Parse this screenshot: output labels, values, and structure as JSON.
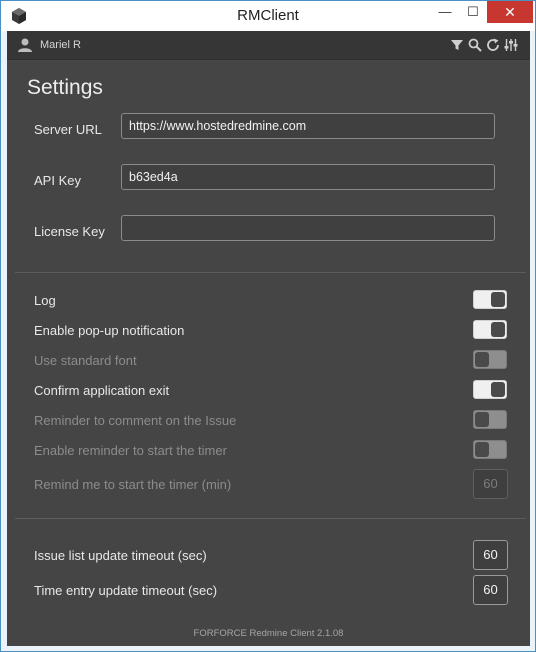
{
  "window": {
    "title": "RMClient",
    "controls": {
      "minimize": "—",
      "maximize": "☐",
      "close": "✕"
    }
  },
  "userbar": {
    "user_name": "Mariel R",
    "tools": [
      "filter-icon",
      "search-icon",
      "refresh-icon",
      "settings-sliders-icon"
    ]
  },
  "settings": {
    "title": "Settings",
    "server_url": {
      "label": "Server URL",
      "value": "https://www.hostedredmine.com"
    },
    "api_key": {
      "label": "API Key",
      "value": "b63ed4a"
    },
    "license_key": {
      "label": "License Key",
      "value": ""
    },
    "toggles": [
      {
        "label": "Log",
        "on": true,
        "enabled": true
      },
      {
        "label": "Enable pop-up notification",
        "on": true,
        "enabled": true
      },
      {
        "label": "Use standard font",
        "on": false,
        "enabled": false
      },
      {
        "label": "Confirm application exit",
        "on": true,
        "enabled": true
      },
      {
        "label": "Reminder to comment on the Issue",
        "on": false,
        "enabled": false
      },
      {
        "label": "Enable reminder to start the timer",
        "on": false,
        "enabled": false
      }
    ],
    "remind_timer": {
      "label": "Remind me to start the timer (min)",
      "value": "60",
      "enabled": false
    },
    "issue_timeout": {
      "label": "Issue list update timeout (sec)",
      "value": "60"
    },
    "time_entry_timeout": {
      "label": "Time entry update timeout (sec)",
      "value": "60"
    },
    "footer": "FORFORCE Redmine Client 2.1.08"
  },
  "colors": {
    "accent_close": "#c7372f",
    "panel_bg": "#454545",
    "toggle_on": "#f0f0f0",
    "toggle_off": "#8e8e8e"
  }
}
